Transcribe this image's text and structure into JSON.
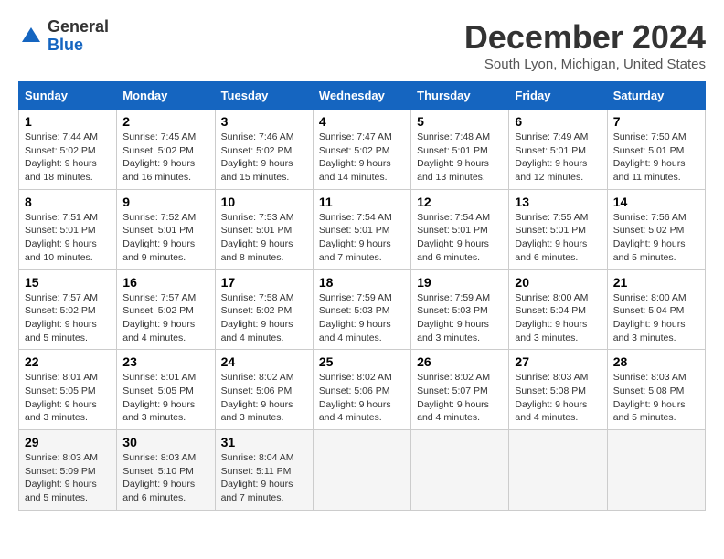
{
  "header": {
    "logo_general": "General",
    "logo_blue": "Blue",
    "month": "December 2024",
    "location": "South Lyon, Michigan, United States"
  },
  "weekdays": [
    "Sunday",
    "Monday",
    "Tuesday",
    "Wednesday",
    "Thursday",
    "Friday",
    "Saturday"
  ],
  "weeks": [
    [
      {
        "day": "1",
        "sunrise": "Sunrise: 7:44 AM",
        "sunset": "Sunset: 5:02 PM",
        "daylight": "Daylight: 9 hours and 18 minutes."
      },
      {
        "day": "2",
        "sunrise": "Sunrise: 7:45 AM",
        "sunset": "Sunset: 5:02 PM",
        "daylight": "Daylight: 9 hours and 16 minutes."
      },
      {
        "day": "3",
        "sunrise": "Sunrise: 7:46 AM",
        "sunset": "Sunset: 5:02 PM",
        "daylight": "Daylight: 9 hours and 15 minutes."
      },
      {
        "day": "4",
        "sunrise": "Sunrise: 7:47 AM",
        "sunset": "Sunset: 5:02 PM",
        "daylight": "Daylight: 9 hours and 14 minutes."
      },
      {
        "day": "5",
        "sunrise": "Sunrise: 7:48 AM",
        "sunset": "Sunset: 5:01 PM",
        "daylight": "Daylight: 9 hours and 13 minutes."
      },
      {
        "day": "6",
        "sunrise": "Sunrise: 7:49 AM",
        "sunset": "Sunset: 5:01 PM",
        "daylight": "Daylight: 9 hours and 12 minutes."
      },
      {
        "day": "7",
        "sunrise": "Sunrise: 7:50 AM",
        "sunset": "Sunset: 5:01 PM",
        "daylight": "Daylight: 9 hours and 11 minutes."
      }
    ],
    [
      {
        "day": "8",
        "sunrise": "Sunrise: 7:51 AM",
        "sunset": "Sunset: 5:01 PM",
        "daylight": "Daylight: 9 hours and 10 minutes."
      },
      {
        "day": "9",
        "sunrise": "Sunrise: 7:52 AM",
        "sunset": "Sunset: 5:01 PM",
        "daylight": "Daylight: 9 hours and 9 minutes."
      },
      {
        "day": "10",
        "sunrise": "Sunrise: 7:53 AM",
        "sunset": "Sunset: 5:01 PM",
        "daylight": "Daylight: 9 hours and 8 minutes."
      },
      {
        "day": "11",
        "sunrise": "Sunrise: 7:54 AM",
        "sunset": "Sunset: 5:01 PM",
        "daylight": "Daylight: 9 hours and 7 minutes."
      },
      {
        "day": "12",
        "sunrise": "Sunrise: 7:54 AM",
        "sunset": "Sunset: 5:01 PM",
        "daylight": "Daylight: 9 hours and 6 minutes."
      },
      {
        "day": "13",
        "sunrise": "Sunrise: 7:55 AM",
        "sunset": "Sunset: 5:01 PM",
        "daylight": "Daylight: 9 hours and 6 minutes."
      },
      {
        "day": "14",
        "sunrise": "Sunrise: 7:56 AM",
        "sunset": "Sunset: 5:02 PM",
        "daylight": "Daylight: 9 hours and 5 minutes."
      }
    ],
    [
      {
        "day": "15",
        "sunrise": "Sunrise: 7:57 AM",
        "sunset": "Sunset: 5:02 PM",
        "daylight": "Daylight: 9 hours and 5 minutes."
      },
      {
        "day": "16",
        "sunrise": "Sunrise: 7:57 AM",
        "sunset": "Sunset: 5:02 PM",
        "daylight": "Daylight: 9 hours and 4 minutes."
      },
      {
        "day": "17",
        "sunrise": "Sunrise: 7:58 AM",
        "sunset": "Sunset: 5:02 PM",
        "daylight": "Daylight: 9 hours and 4 minutes."
      },
      {
        "day": "18",
        "sunrise": "Sunrise: 7:59 AM",
        "sunset": "Sunset: 5:03 PM",
        "daylight": "Daylight: 9 hours and 4 minutes."
      },
      {
        "day": "19",
        "sunrise": "Sunrise: 7:59 AM",
        "sunset": "Sunset: 5:03 PM",
        "daylight": "Daylight: 9 hours and 3 minutes."
      },
      {
        "day": "20",
        "sunrise": "Sunrise: 8:00 AM",
        "sunset": "Sunset: 5:04 PM",
        "daylight": "Daylight: 9 hours and 3 minutes."
      },
      {
        "day": "21",
        "sunrise": "Sunrise: 8:00 AM",
        "sunset": "Sunset: 5:04 PM",
        "daylight": "Daylight: 9 hours and 3 minutes."
      }
    ],
    [
      {
        "day": "22",
        "sunrise": "Sunrise: 8:01 AM",
        "sunset": "Sunset: 5:05 PM",
        "daylight": "Daylight: 9 hours and 3 minutes."
      },
      {
        "day": "23",
        "sunrise": "Sunrise: 8:01 AM",
        "sunset": "Sunset: 5:05 PM",
        "daylight": "Daylight: 9 hours and 3 minutes."
      },
      {
        "day": "24",
        "sunrise": "Sunrise: 8:02 AM",
        "sunset": "Sunset: 5:06 PM",
        "daylight": "Daylight: 9 hours and 3 minutes."
      },
      {
        "day": "25",
        "sunrise": "Sunrise: 8:02 AM",
        "sunset": "Sunset: 5:06 PM",
        "daylight": "Daylight: 9 hours and 4 minutes."
      },
      {
        "day": "26",
        "sunrise": "Sunrise: 8:02 AM",
        "sunset": "Sunset: 5:07 PM",
        "daylight": "Daylight: 9 hours and 4 minutes."
      },
      {
        "day": "27",
        "sunrise": "Sunrise: 8:03 AM",
        "sunset": "Sunset: 5:08 PM",
        "daylight": "Daylight: 9 hours and 4 minutes."
      },
      {
        "day": "28",
        "sunrise": "Sunrise: 8:03 AM",
        "sunset": "Sunset: 5:08 PM",
        "daylight": "Daylight: 9 hours and 5 minutes."
      }
    ],
    [
      {
        "day": "29",
        "sunrise": "Sunrise: 8:03 AM",
        "sunset": "Sunset: 5:09 PM",
        "daylight": "Daylight: 9 hours and 5 minutes."
      },
      {
        "day": "30",
        "sunrise": "Sunrise: 8:03 AM",
        "sunset": "Sunset: 5:10 PM",
        "daylight": "Daylight: 9 hours and 6 minutes."
      },
      {
        "day": "31",
        "sunrise": "Sunrise: 8:04 AM",
        "sunset": "Sunset: 5:11 PM",
        "daylight": "Daylight: 9 hours and 7 minutes."
      },
      null,
      null,
      null,
      null
    ]
  ]
}
